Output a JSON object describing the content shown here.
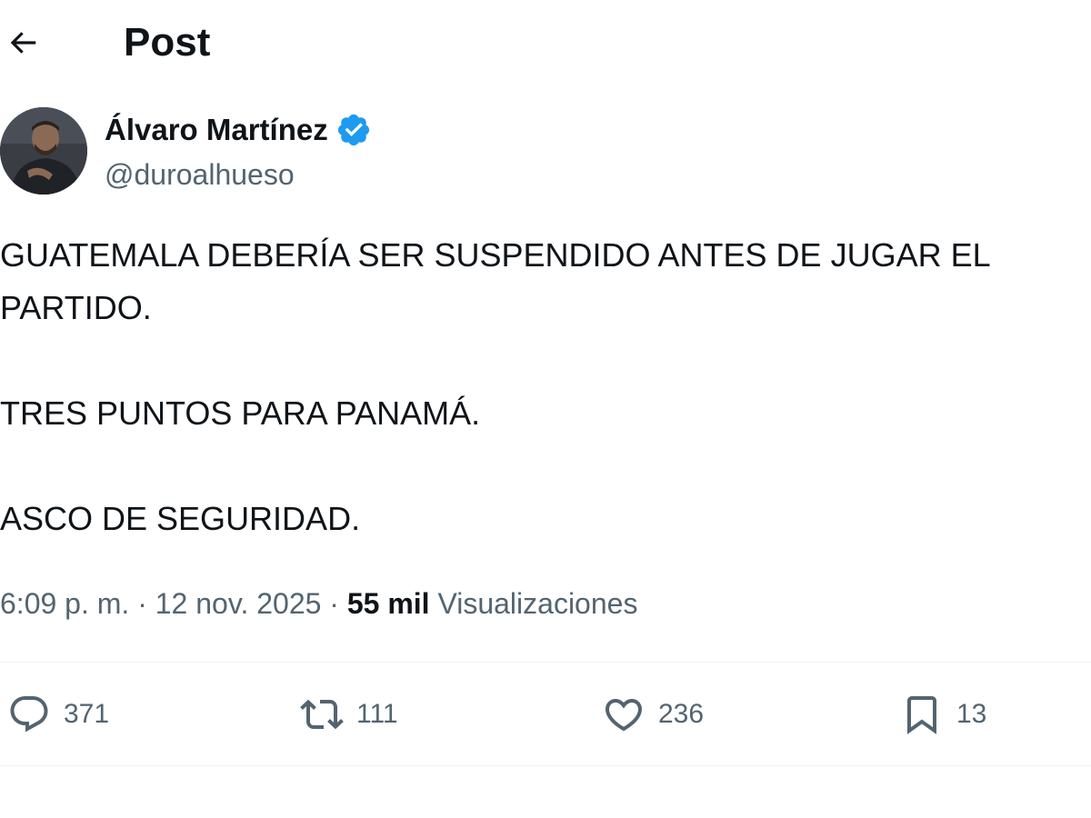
{
  "header": {
    "title": "Post",
    "back_icon": "arrow-left-icon"
  },
  "author": {
    "name": "Álvaro Martínez",
    "handle": "@duroalhueso",
    "verified": true,
    "verified_color": "#1d9bf0"
  },
  "post": {
    "paragraphs": [
      "GUATEMALA DEBERÍA SER SUSPENDIDO ANTES DE JUGAR EL PARTIDO.",
      "TRES PUNTOS PARA PANAMÁ.",
      "ASCO DE SEGURIDAD."
    ]
  },
  "meta": {
    "time": "6:09 p. m.",
    "separator": "·",
    "date": "12 nov. 2025",
    "views_count": "55 mil",
    "views_label": "Visualizaciones"
  },
  "actions": {
    "reply": {
      "icon": "reply-icon",
      "count": "371"
    },
    "repost": {
      "icon": "repost-icon",
      "count": "111"
    },
    "like": {
      "icon": "heart-icon",
      "count": "236"
    },
    "bookmark": {
      "icon": "bookmark-icon",
      "count": "13"
    }
  },
  "colors": {
    "text_primary": "#0f1419",
    "text_secondary": "#536471",
    "divider": "#eff3f4"
  }
}
